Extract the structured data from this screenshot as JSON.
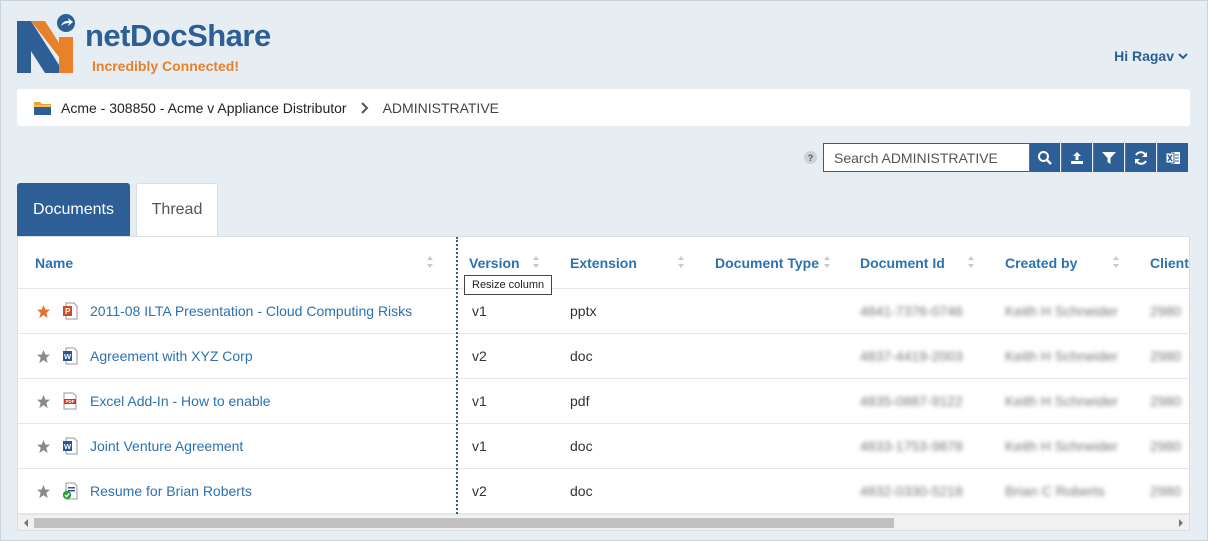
{
  "brand": {
    "name": "netDocShare",
    "tagline": "Incredibly Connected!"
  },
  "user": {
    "greeting": "Hi Ragav"
  },
  "breadcrumb": {
    "folder_label": "Acme - 308850 - Acme v Appliance Distributor",
    "current": "ADMINISTRATIVE"
  },
  "search": {
    "placeholder": "Search ADMINISTRATIVE",
    "value": "",
    "help": "?"
  },
  "toolbar": [
    "search-icon",
    "upload-icon",
    "filter-icon",
    "refresh-icon",
    "excel-export-icon"
  ],
  "tabs": [
    {
      "label": "Documents",
      "active": true
    },
    {
      "label": "Thread",
      "active": false
    }
  ],
  "table": {
    "columns": [
      "Name",
      "Version",
      "Extension",
      "Document Type",
      "Document Id",
      "Created by",
      "Client"
    ],
    "tooltip": "Resize column",
    "rows": [
      {
        "starred": true,
        "icon": "powerpoint-file-icon",
        "name": "2011-08 ILTA Presentation - Cloud Computing Risks",
        "version": "v1",
        "extension": "pptx",
        "doc_type": "",
        "doc_id": "4841-7376-0746",
        "created_by": "Keith H Schneider",
        "client": "2980"
      },
      {
        "starred": false,
        "icon": "word-file-icon",
        "name": "Agreement with XYZ Corp",
        "version": "v2",
        "extension": "doc",
        "doc_type": "",
        "doc_id": "4837-4419-2003",
        "created_by": "Keith H Schneider",
        "client": "2980"
      },
      {
        "starred": false,
        "icon": "pdf-file-icon",
        "name": "Excel Add-In - How to enable",
        "version": "v1",
        "extension": "pdf",
        "doc_type": "",
        "doc_id": "4835-0887-9122",
        "created_by": "Keith H Schneider",
        "client": "2980"
      },
      {
        "starred": false,
        "icon": "word-file-icon",
        "name": "Joint Venture Agreement",
        "version": "v1",
        "extension": "doc",
        "doc_type": "",
        "doc_id": "4833-1753-9878",
        "created_by": "Keith H Schneider",
        "client": "2980"
      },
      {
        "starred": false,
        "icon": "word-checked-file-icon",
        "name": "Resume for Brian Roberts",
        "version": "v2",
        "extension": "doc",
        "doc_type": "",
        "doc_id": "4832-0330-5218",
        "created_by": "Brian C Roberts",
        "client": "2980"
      }
    ]
  },
  "colors": {
    "primary": "#2d5f96",
    "link": "#2b72b0",
    "accent": "#e8822a",
    "star_active": "#e8722a",
    "star_inactive": "#8a8a8a"
  }
}
